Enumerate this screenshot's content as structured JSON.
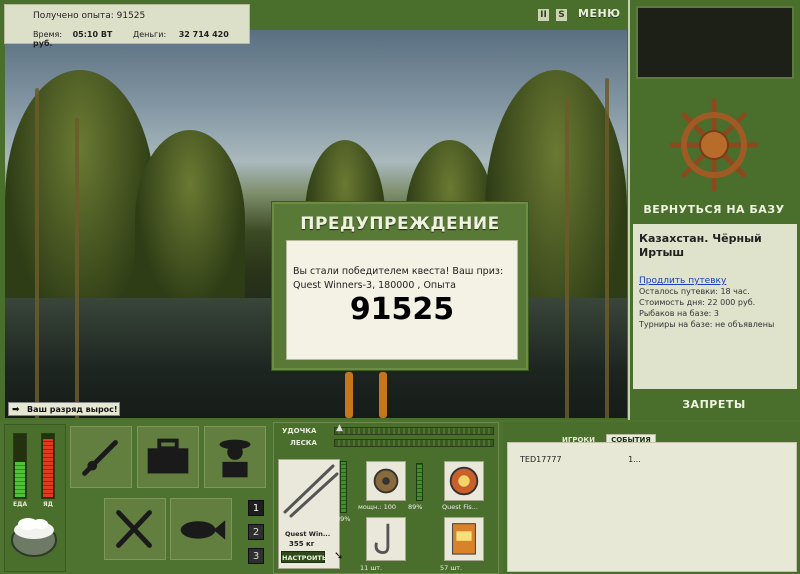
{
  "hud": {
    "experience_label": "Получено опыта:",
    "experience_value": "91525",
    "time_label": "Время:",
    "time_value": "05:10 ВТ",
    "money_label": "Деньги:",
    "money_value": "32 714 420 руб.",
    "pause_label": "II",
    "sound_label": "S",
    "menu_label": "МЕНЮ"
  },
  "rank_notice": "Ваш разряд вырос!",
  "warning": {
    "title": "ПРЕДУПРЕЖДЕНИЕ",
    "message": "Вы стали победителем квеста! Ваш приз: Quest Winners-3, 180000 , Опыта",
    "amount": "91525"
  },
  "sidebar": {
    "return_label": "ВЕРНУТЬСЯ НА БАЗУ",
    "location": "Казахстан. Чёрный Иртыш",
    "extend_link": "Продлить путевку",
    "voucher_left": "Осталось путевки: 18 час.",
    "day_cost": "Стоимость дня: 22 000 руб.",
    "fishers": "Рыбаков на базе: 3",
    "tournaments": "Турниры на базе: не объявлены",
    "bans_label": "ЗАПРЕТЫ"
  },
  "status": {
    "food_label": "ЕДА",
    "food_level": 0.55,
    "health_label": "ЯД",
    "health_level": 0.9
  },
  "pages": [
    "1",
    "2",
    "3"
  ],
  "tackle": {
    "rod_label": "УДОЧКА",
    "line_label": "ЛЕСКА",
    "rod_name": "Quest Win...",
    "rod_weight": "355 кг",
    "rod_percent": "89%",
    "reel_power": "мощн.: 100",
    "reel_percent": "89%",
    "line_name": "Quest Fis...",
    "hooks_count": "11 шт.",
    "bait_count": "57 шт.",
    "setup_label": "НАСТРОИТЬ"
  },
  "chat": {
    "tabs": [
      "ИГРОКИ",
      "СОБЫТИЯ"
    ],
    "rows": [
      {
        "name": "TED17777",
        "value": "1..."
      }
    ]
  },
  "colors": {
    "panel_green": "#4a6e2b",
    "dialog_green": "#587a36",
    "paper": "#f4f2e4",
    "link_blue": "#1a3fc0"
  }
}
